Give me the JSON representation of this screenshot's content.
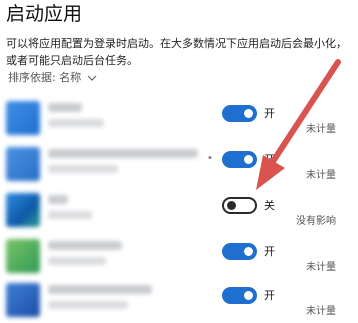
{
  "page": {
    "title": "启动应用",
    "description": "可以将应用配置为登录时启动。在大多数情况下应用启动后会最小化，或者可能只启动后台任务。",
    "sort_label": "排序依据: 名称",
    "sort_icon": "chevron-down-icon"
  },
  "apps": [
    {
      "toggle": "on",
      "state_label": "开",
      "impact": "未计量"
    },
    {
      "toggle": "on",
      "state_label": "开",
      "impact": "未计量"
    },
    {
      "toggle": "off",
      "state_label": "关",
      "impact": "没有影响"
    },
    {
      "toggle": "on",
      "state_label": "开",
      "impact": "未计量"
    },
    {
      "toggle": "on",
      "state_label": "开",
      "impact": "未计量"
    }
  ],
  "colors": {
    "toggle_on": "#1f6fd1",
    "toggle_off_border": "#2a2a2a",
    "annotation_arrow": "#d9534f"
  }
}
